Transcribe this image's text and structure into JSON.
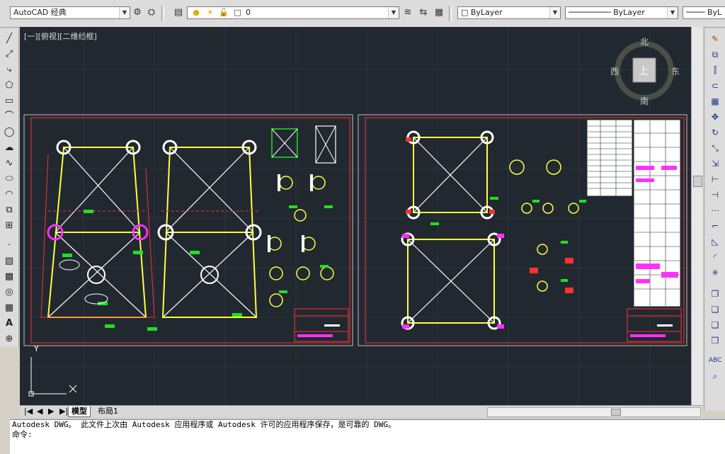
{
  "toolbar": {
    "workspace": "AutoCAD 经典",
    "layer": "0",
    "color": "ByLayer",
    "linetype": "ByLayer",
    "lineweight": "ByL"
  },
  "viewport": {
    "label": "[一][俯视][二维线框]",
    "viewcube_top": "上",
    "north": "北",
    "south": "南",
    "east": "东",
    "west": "西",
    "ucs_y": "Y"
  },
  "tabs": [
    "模型",
    "布局1"
  ],
  "command": {
    "history": "Autodesk DWG。  此文件上次由 Autodesk 应用程序或 Autodesk 许可的应用程序保存，是可靠的 DWG。",
    "prompt": "命令:"
  },
  "colors": {
    "canvas": "#212830",
    "red": "#ff3030",
    "yellow": "#ffff40",
    "white": "#ffffff",
    "green": "#20e020",
    "magenta": "#ff30ff",
    "cyan": "#30ffff"
  }
}
